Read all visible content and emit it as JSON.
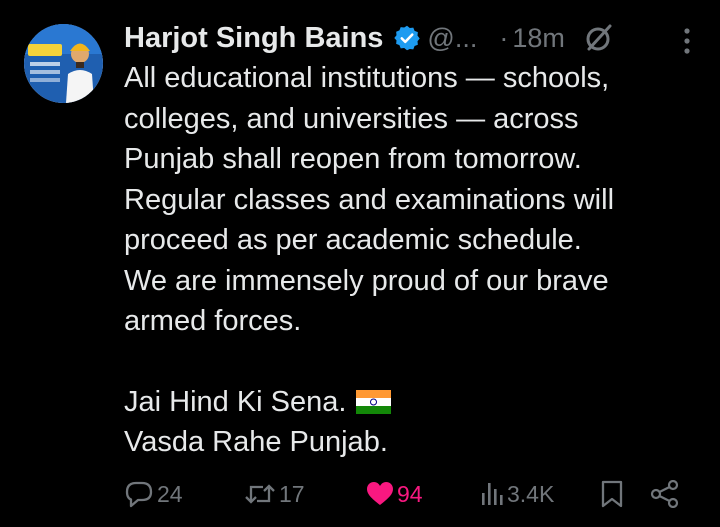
{
  "tweet": {
    "author": {
      "name": "Harjot Singh Bains",
      "handle": "@...",
      "avatar_icon": "profile-avatar"
    },
    "separator": "·",
    "time": "18m",
    "text": {
      "lines": [
        "All educational institutions — schools,",
        "colleges, and universities — across",
        "Punjab shall reopen from tomorrow.",
        "Regular classes and examinations will",
        "proceed as per academic schedule.",
        "We are immensely proud of our brave",
        "armed forces."
      ],
      "closing": [
        "Jai Hind Ki Sena.",
        "Vasda Rahe Punjab."
      ],
      "emoji": "india-flag"
    },
    "stats": {
      "replies": "24",
      "reposts": "17",
      "likes": "94",
      "views": "3.4K"
    }
  },
  "colors": {
    "background": "#000000",
    "text": "#e7e9ea",
    "muted": "#71767b",
    "verified": "#1d9bf0",
    "like": "#f91880"
  }
}
